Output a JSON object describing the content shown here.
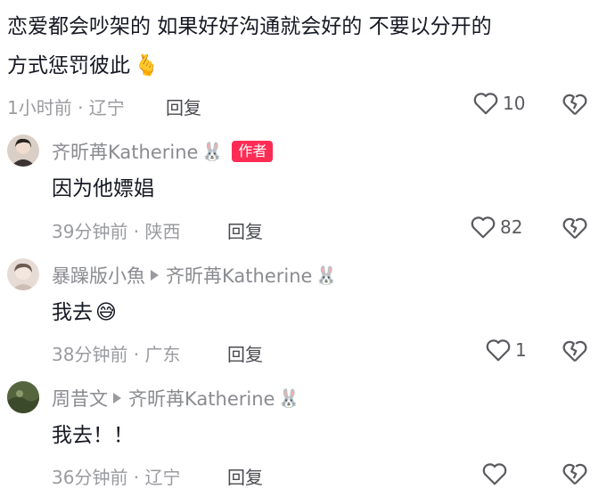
{
  "top_comment": {
    "line1": "恋爱都会吵架的 如果好好沟通就会好的 不要以分开的",
    "line2": "方式惩罚彼此",
    "emoji": "🫰",
    "time_location": "1小时前 · 辽宁",
    "reply_label": "回复",
    "like_count": "10"
  },
  "replies": [
    {
      "username": "齐昕苒Katherine",
      "emoji": "🐰",
      "badge": "作者",
      "text": "因为他嫖娼",
      "time_location": "39分钟前 · 陕西",
      "reply_label": "回复",
      "like_count": "82"
    },
    {
      "username": "暴躁版小魚",
      "reply_to": "齐昕苒Katherine",
      "reply_to_emoji": "🐰",
      "text": "我去",
      "text_emoji": "😅",
      "time_location": "38分钟前 · 广东",
      "reply_label": "回复",
      "like_count": "1"
    },
    {
      "username": "周昔文",
      "reply_to": "齐昕苒Katherine",
      "reply_to_emoji": "🐰",
      "text": "我去！！",
      "time_location": "36分钟前 · 辽宁",
      "reply_label": "回复",
      "like_count": ""
    }
  ],
  "colors": {
    "badge": "#fe2c55",
    "text": "#161823",
    "meta": "#9a9ba0"
  },
  "icons": [
    "heart-icon",
    "broken-heart-icon",
    "play-arrow-icon"
  ]
}
